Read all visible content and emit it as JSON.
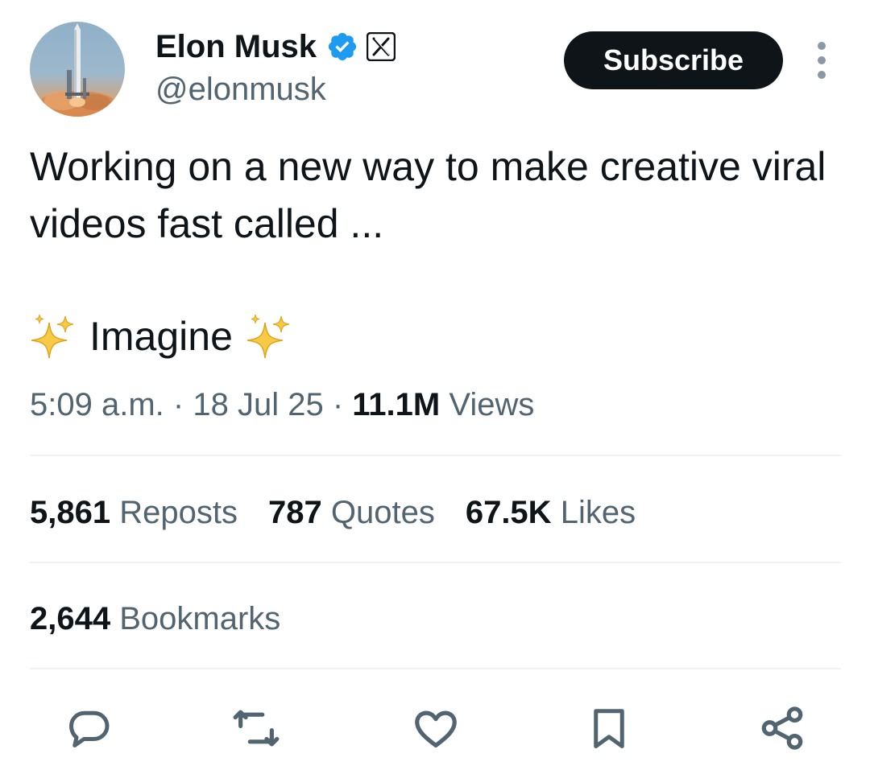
{
  "author": {
    "display_name": "Elon Musk",
    "handle": "@elonmusk",
    "verified_icon": "verified-badge-icon",
    "affiliate_icon": "x-logo-icon",
    "avatar": "rocket-launch-avatar"
  },
  "header": {
    "subscribe_label": "Subscribe",
    "more_icon": "more-options-icon"
  },
  "tweet": {
    "text": "Working on a new way to make creative viral videos fast called ...",
    "highlight_word": "Imagine",
    "sparkles_icon": "sparkles-icon"
  },
  "meta": {
    "time": "5:09 a.m.",
    "separator": "·",
    "date": "18 Jul 25",
    "views_count": "11.1M",
    "views_label": "Views"
  },
  "stats": {
    "reposts_count": "5,861",
    "reposts_label": "Reposts",
    "quotes_count": "787",
    "quotes_label": "Quotes",
    "likes_count": "67.5K",
    "likes_label": "Likes",
    "bookmarks_count": "2,644",
    "bookmarks_label": "Bookmarks"
  },
  "actions": [
    "reply-icon",
    "repost-icon",
    "like-icon",
    "bookmark-icon",
    "share-icon"
  ],
  "colors": {
    "text_primary": "#0f1419",
    "text_secondary": "#536471",
    "verified_blue": "#1d9bf0",
    "divider": "#eff3f4",
    "button_bg": "#0f1419",
    "button_text": "#ffffff"
  }
}
